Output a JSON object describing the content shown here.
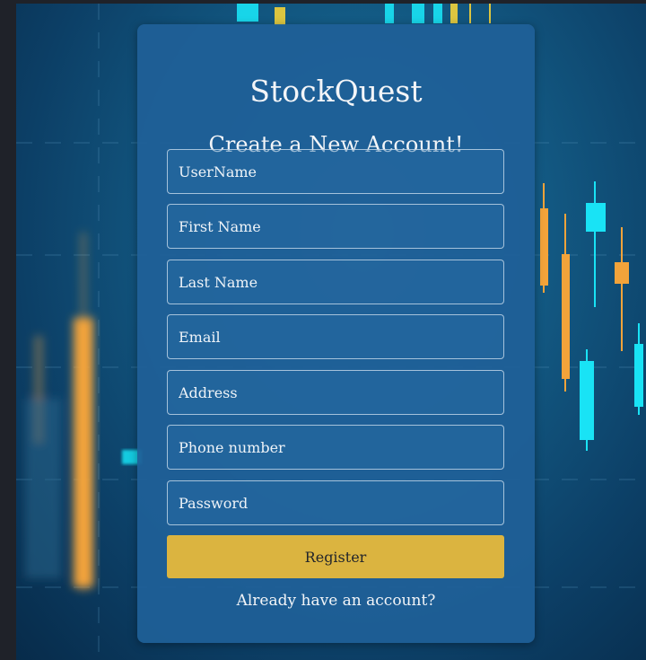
{
  "app": {
    "brand": "StockQuest",
    "subtitle": "Create a New Account!"
  },
  "form": {
    "fields": [
      {
        "name": "username",
        "placeholder": "UserName",
        "value": ""
      },
      {
        "name": "first_name",
        "placeholder": "First Name",
        "value": ""
      },
      {
        "name": "last_name",
        "placeholder": "Last Name",
        "value": ""
      },
      {
        "name": "email",
        "placeholder": "Email",
        "value": ""
      },
      {
        "name": "address",
        "placeholder": "Address",
        "value": ""
      },
      {
        "name": "phone",
        "placeholder": "Phone number",
        "value": ""
      },
      {
        "name": "password",
        "placeholder": "Password",
        "value": ""
      }
    ],
    "register_label": "Register",
    "login_link": "Already have an account?"
  },
  "colors": {
    "accent": "#dbb440",
    "card": "#1f6098",
    "candle_up": "#19e3f5",
    "candle_down": "#f2a33a"
  }
}
